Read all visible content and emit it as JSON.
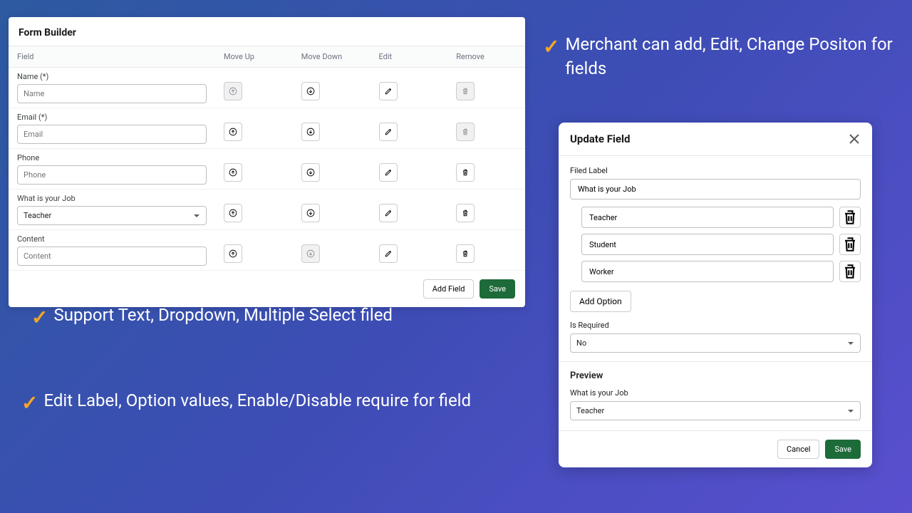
{
  "builder": {
    "title": "Form Builder",
    "columns": [
      "Field",
      "Move Up",
      "Move Down",
      "Edit",
      "Remove"
    ],
    "rows": [
      {
        "label": "Name (*)",
        "placeholder": "Name",
        "type": "text",
        "upDisabled": true,
        "removeDisabled": true
      },
      {
        "label": "Email (*)",
        "placeholder": "Email",
        "type": "text",
        "removeDisabled": true
      },
      {
        "label": "Phone",
        "placeholder": "Phone",
        "type": "text"
      },
      {
        "label": "What is your Job",
        "value": "Teacher",
        "type": "select"
      },
      {
        "label": "Content",
        "placeholder": "Content",
        "type": "text",
        "downDisabled": true
      }
    ],
    "addFieldLabel": "Add Field",
    "saveLabel": "Save"
  },
  "features": {
    "f1": "Support Text, Dropdown, Multiple Select filed",
    "f2": "Edit Label, Option values, Enable/Disable require for field",
    "f3": "Merchant can add, Edit, Change Positon for fields"
  },
  "modal": {
    "title": "Update Field",
    "fieldLabelLabel": "Filed Label",
    "fieldLabelValue": "What is your Job",
    "options": [
      "Teacher",
      "Student",
      "Worker"
    ],
    "addOptionLabel": "Add Option",
    "isRequiredLabel": "Is Required",
    "isRequiredValue": "No",
    "previewTitle": "Preview",
    "previewLabel": "What is your Job",
    "previewValue": "Teacher",
    "cancelLabel": "Cancel",
    "saveLabel": "Save"
  }
}
